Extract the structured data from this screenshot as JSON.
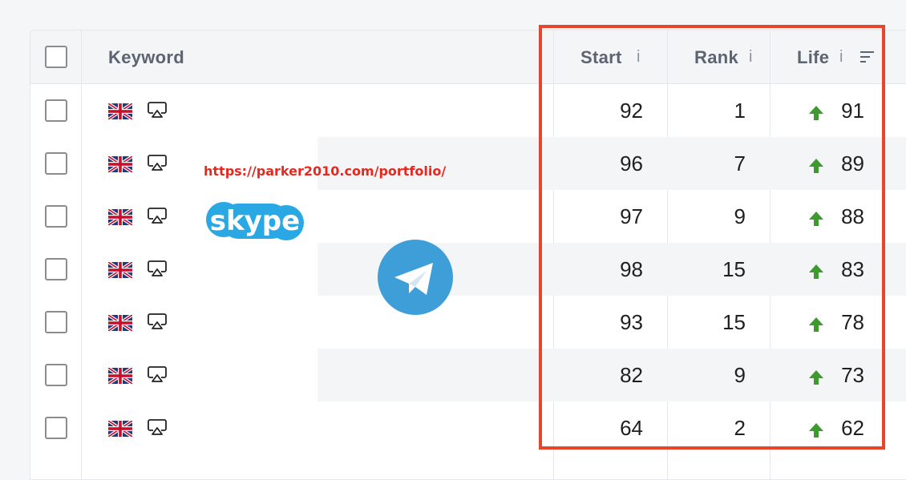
{
  "table": {
    "header": {
      "keyword": "Keyword",
      "start": "Start",
      "rank": "Rank",
      "life": "Life",
      "info": "i"
    },
    "rows": [
      {
        "start": "92",
        "rank": "1",
        "life": "91"
      },
      {
        "start": "96",
        "rank": "7",
        "life": "89"
      },
      {
        "start": "97",
        "rank": "9",
        "life": "88"
      },
      {
        "start": "98",
        "rank": "15",
        "life": "83"
      },
      {
        "start": "93",
        "rank": "15",
        "life": "78"
      },
      {
        "start": "82",
        "rank": "9",
        "life": "73"
      },
      {
        "start": "64",
        "rank": "2",
        "life": "62"
      }
    ]
  },
  "overlay": {
    "url": "https://parker2010.com/portfolio/",
    "skype": "skype"
  },
  "colors": {
    "highlight": "#e8452c",
    "arrow": "#3e9a2f",
    "url": "#e8281e"
  },
  "icons": {
    "flag": "uk-flag-icon",
    "device": "airplay-monitor-icon",
    "trend": "arrow-up-icon",
    "sort": "sort-icon"
  }
}
